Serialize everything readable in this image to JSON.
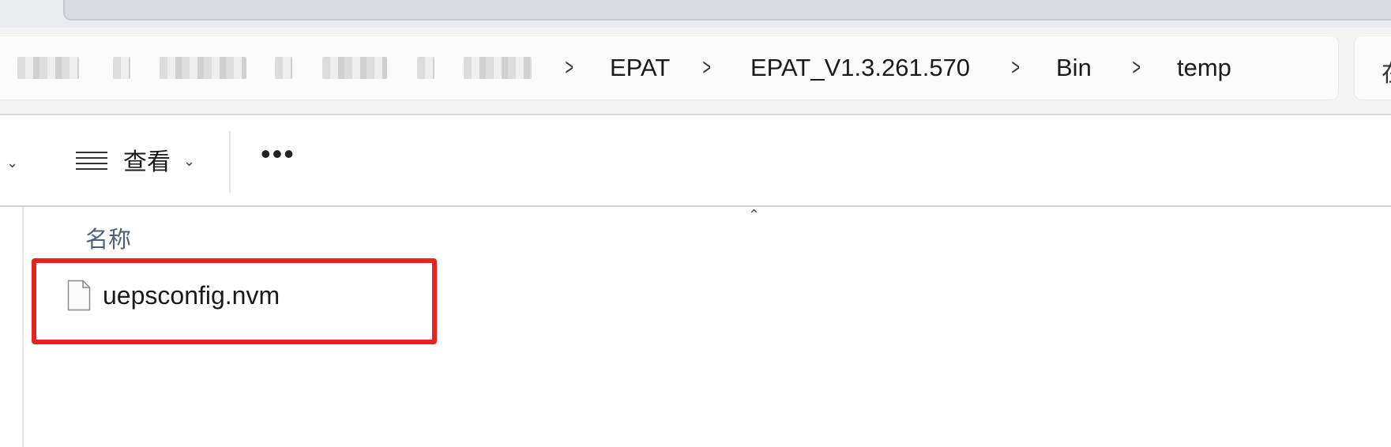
{
  "breadcrumb": {
    "blurred_count": 6,
    "items": [
      "EPAT",
      "EPAT_V1.3.261.570",
      "Bin",
      "temp"
    ]
  },
  "search": {
    "partial_text": "在"
  },
  "toolbar": {
    "view_label": "查看",
    "more_label": "•••"
  },
  "file_list": {
    "column_name": "名称",
    "files": [
      {
        "name": "uepsconfig.nvm",
        "icon": "generic-file-icon"
      }
    ]
  },
  "annotation": {
    "highlight_color": "#e8231f"
  },
  "icons": {
    "chevron": "chevron-right-icon",
    "view": "list-view-icon",
    "dropdown": "chevron-down-icon",
    "sort": "sort-ascending-caret-icon"
  }
}
